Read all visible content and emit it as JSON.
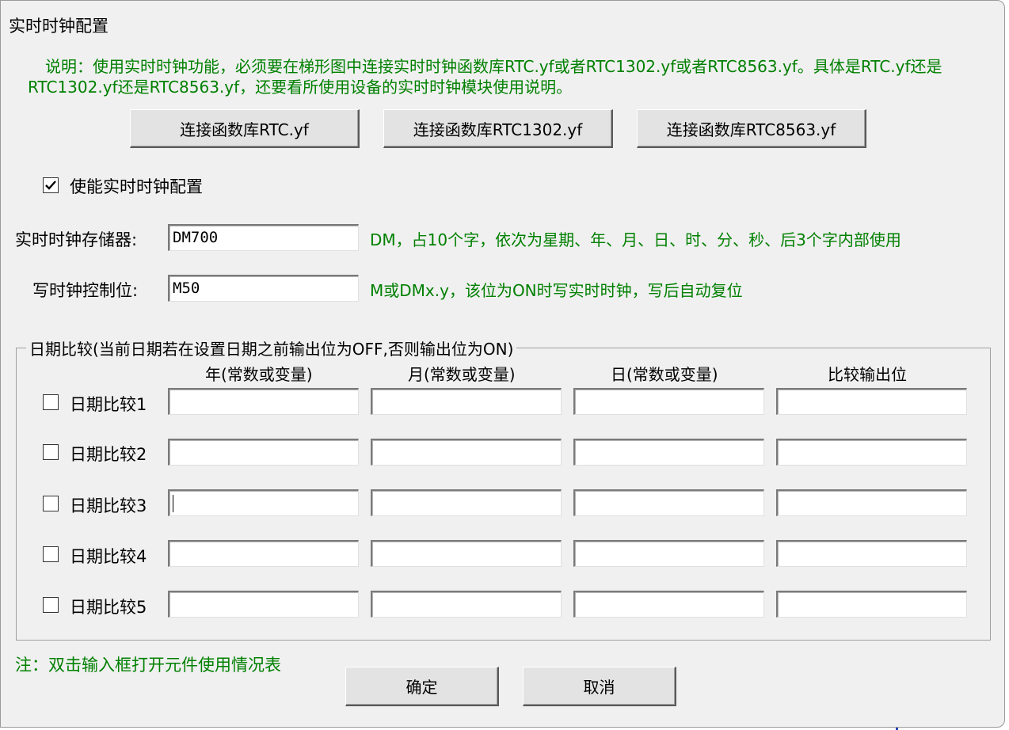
{
  "dialog": {
    "title": "实时时钟配置",
    "note": "说明：使用实时时钟功能，必须要在梯形图中连接实时时钟函数库RTC.yf或者RTC1302.yf或者RTC8563.yf。具体是RTC.yf还是RTC1302.yf还是RTC8563.yf，还要看所使用设备的实时时钟模块使用说明。",
    "buttons": {
      "lib_rtc": "连接函数库RTC.yf",
      "lib_rtc1302": "连接函数库RTC1302.yf",
      "lib_rtc8563": "连接函数库RTC8563.yf"
    },
    "enable": {
      "label": "使能实时时钟配置",
      "checked": true
    },
    "storage": {
      "label": "实时时钟存储器:",
      "value": "DM700",
      "hint": "DM，占10个字，依次为星期、年、月、日、时、分、秒、后3个字内部使用"
    },
    "control": {
      "label": "写时钟控制位:",
      "value": "M50",
      "hint": "M或DMx.y，该位为ON时写实时时钟，写后自动复位"
    },
    "date_compare": {
      "group_title": "日期比较(当前日期若在设置日期之前输出位为OFF,否则输出位为ON)",
      "columns": [
        "年(常数或变量)",
        "月(常数或变量)",
        "日(常数或变量)",
        "比较输出位"
      ],
      "rows": [
        {
          "label": "日期比较1",
          "checked": false,
          "values": [
            "",
            "",
            "",
            ""
          ]
        },
        {
          "label": "日期比较2",
          "checked": false,
          "values": [
            "",
            "",
            "",
            ""
          ]
        },
        {
          "label": "日期比较3",
          "checked": false,
          "values": [
            "",
            "",
            "",
            ""
          ]
        },
        {
          "label": "日期比较4",
          "checked": false,
          "values": [
            "",
            "",
            "",
            ""
          ]
        },
        {
          "label": "日期比较5",
          "checked": false,
          "values": [
            "",
            "",
            "",
            ""
          ]
        }
      ]
    },
    "footer_note": "注：双击输入框打开元件使用情况表",
    "ok_label": "确定",
    "cancel_label": "取消",
    "colors": {
      "hint_green": "#008000",
      "dialog_bg": "#f0f0f0"
    }
  }
}
